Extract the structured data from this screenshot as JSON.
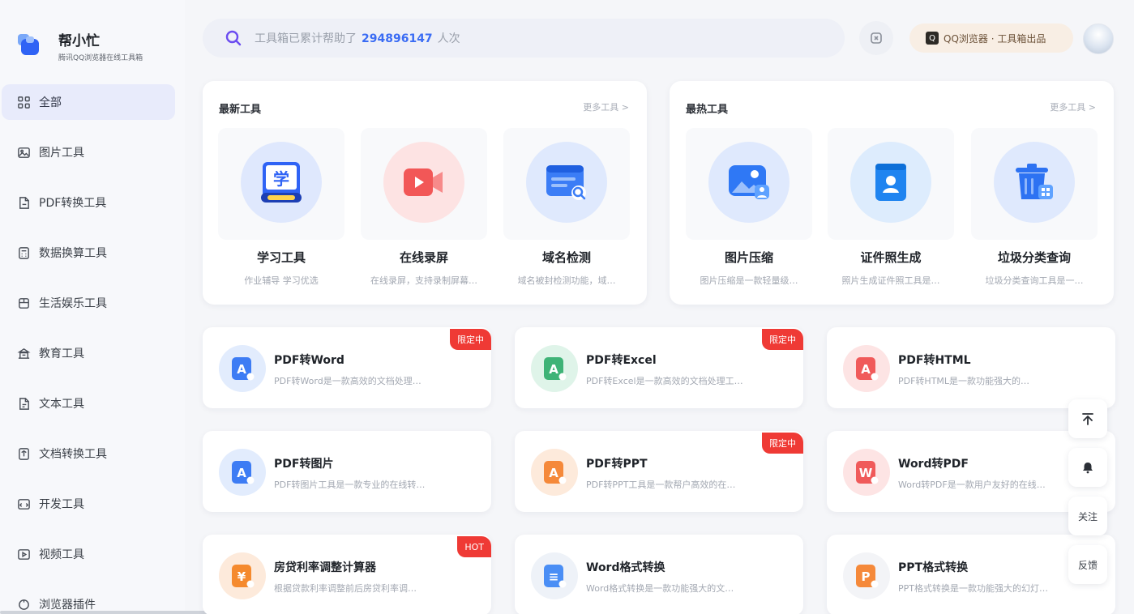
{
  "brand": {
    "name": "帮小忙",
    "subtitle": "腾讯QQ浏览器在线工具箱"
  },
  "sidebar": {
    "items": [
      {
        "label": "全部",
        "icon": "grid-icon",
        "active": true
      },
      {
        "label": "图片工具",
        "icon": "image-icon"
      },
      {
        "label": "PDF转换工具",
        "icon": "pdf-file-icon"
      },
      {
        "label": "数据换算工具",
        "icon": "calculator-icon"
      },
      {
        "label": "生活娱乐工具",
        "icon": "life-icon"
      },
      {
        "label": "教育工具",
        "icon": "education-icon"
      },
      {
        "label": "文本工具",
        "icon": "text-file-icon"
      },
      {
        "label": "文档转换工具",
        "icon": "doc-convert-icon"
      },
      {
        "label": "开发工具",
        "icon": "dev-icon"
      },
      {
        "label": "视频工具",
        "icon": "video-icon"
      },
      {
        "label": "浏览器插件",
        "icon": "plugin-icon"
      }
    ]
  },
  "header": {
    "search_prefix": "工具箱已累计帮助了",
    "search_count": "294896147",
    "search_suffix": "人次",
    "qq_label": "QQ浏览器 · 工具箱出品",
    "qq_mark": "Q"
  },
  "panels": [
    {
      "title": "最新工具",
      "more": "更多工具 >",
      "tools": [
        {
          "name": "学习工具",
          "desc": "作业辅导 学习优选",
          "icon": "study-book-icon",
          "color": "#2f63f5",
          "bg": "#dfe8fd",
          "glyph": "学"
        },
        {
          "name": "在线录屏",
          "desc": "在线录屏，支持录制屏幕…",
          "icon": "screen-record-icon",
          "color": "#f25757",
          "bg": "#fde3e3"
        },
        {
          "name": "域名检测",
          "desc": "域名被封检测功能，域…",
          "icon": "domain-check-icon",
          "color": "#3b7df6",
          "bg": "#dfe9fd"
        }
      ]
    },
    {
      "title": "最热工具",
      "more": "更多工具 >",
      "tools": [
        {
          "name": "图片压缩",
          "desc": "图片压缩是一款轻量级…",
          "icon": "image-compress-icon",
          "color": "#2f78f5",
          "bg": "#dfe9fd"
        },
        {
          "name": "证件照生成",
          "desc": "照片生成证件照工具是…",
          "icon": "id-photo-icon",
          "color": "#1f84f0",
          "bg": "#ddecfd"
        },
        {
          "name": "垃圾分类查询",
          "desc": "垃圾分类查询工具是一…",
          "icon": "trash-sort-icon",
          "color": "#2d72f2",
          "bg": "#dfe9fd"
        }
      ]
    }
  ],
  "cards": [
    {
      "title": "PDF转Word",
      "desc": "PDF转Word是一款高效的文档处理…",
      "icon": "pdf-to-word-icon",
      "color": "#3d7cf4",
      "bg": "#e2ecfd",
      "glyph": "A",
      "badge": "限定中"
    },
    {
      "title": "PDF转Excel",
      "desc": "PDF转Excel是一款高效的文档处理工…",
      "icon": "pdf-to-excel-icon",
      "color": "#3fb377",
      "bg": "#dff4e9",
      "glyph": "A",
      "badge": "限定中"
    },
    {
      "title": "PDF转HTML",
      "desc": "PDF转HTML是一款功能强大的…",
      "icon": "pdf-to-html-icon",
      "color": "#f05a5a",
      "bg": "#fde4e4",
      "glyph": "A",
      "badge": ""
    },
    {
      "title": "PDF转图片",
      "desc": "PDF转图片工具是一款专业的在线转…",
      "icon": "pdf-to-image-icon",
      "color": "#3d7cf4",
      "bg": "#e2ecfd",
      "glyph": "A",
      "badge": ""
    },
    {
      "title": "PDF转PPT",
      "desc": "PDF转PPT工具是一款帮户高效的在…",
      "icon": "pdf-to-ppt-icon",
      "color": "#f5893a",
      "bg": "#fdeadb",
      "glyph": "A",
      "badge": "限定中"
    },
    {
      "title": "Word转PDF",
      "desc": "Word转PDF是一款用户友好的在线…",
      "icon": "word-to-pdf-icon",
      "color": "#f05a5a",
      "bg": "#fde4e4",
      "glyph": "W",
      "badge": ""
    },
    {
      "title": "房贷利率调整计算器",
      "desc": "根据贷款利率调整前后房贷利率调…",
      "icon": "house-loan-icon",
      "color": "#f58a2e",
      "bg": "#fdeadb",
      "glyph": "¥",
      "badge": "HOT"
    },
    {
      "title": "Word格式转换",
      "desc": "Word格式转换是一款功能强大的文…",
      "icon": "word-format-icon",
      "color": "#4a8ef5",
      "bg": "#eef2f8",
      "glyph": "≡",
      "badge": ""
    },
    {
      "title": "PPT格式转换",
      "desc": "PPT格式转换是一款功能强大的幻灯…",
      "icon": "ppt-format-icon",
      "color": "#f5893a",
      "bg": "#f3f4f7",
      "glyph": "P",
      "badge": ""
    }
  ],
  "floating": {
    "top_label": "",
    "bell_label": "",
    "help_label": "关注",
    "feedback_label": "反馈"
  },
  "colors": {
    "accent": "#3a6cf4",
    "badge_red": "#ef3a35",
    "sidebar_active": "#e8ebfb"
  }
}
